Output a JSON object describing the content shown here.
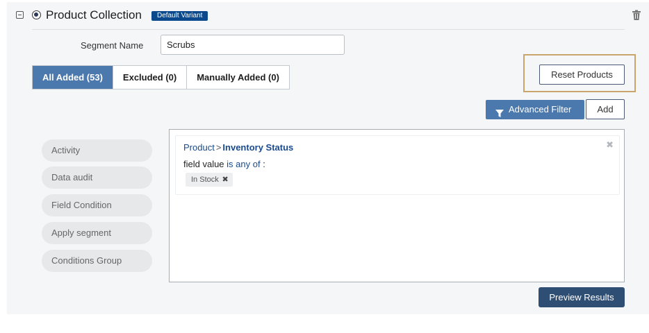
{
  "header": {
    "title": "Product Collection",
    "badge": "Default Variant"
  },
  "segment": {
    "label": "Segment Name",
    "value": "Scrubs"
  },
  "tabs": [
    {
      "label": "All Added (53)",
      "active": true
    },
    {
      "label": "Excluded (0)",
      "active": false
    },
    {
      "label": "Manually Added (0)",
      "active": false
    }
  ],
  "toolbar": {
    "reset_label": "Reset Products",
    "advanced_filter_label": "Advanced Filter",
    "add_label": "Add"
  },
  "side_items": [
    "Activity",
    "Data audit",
    "Field Condition",
    "Apply segment",
    "Conditions Group"
  ],
  "condition": {
    "path_parent": "Product",
    "path_separator": ">",
    "path_field": "Inventory Status",
    "field_text": "field value",
    "operator": "is any of",
    "colon": ":",
    "chip_value": "In Stock",
    "chip_close": "✖",
    "card_close": "✖"
  },
  "footer": {
    "preview_label": "Preview Results"
  },
  "colors": {
    "accent": "#4c79ad",
    "badge": "#0a4a8c",
    "preview": "#2f4e74",
    "highlight_border": "#c9a46b"
  }
}
